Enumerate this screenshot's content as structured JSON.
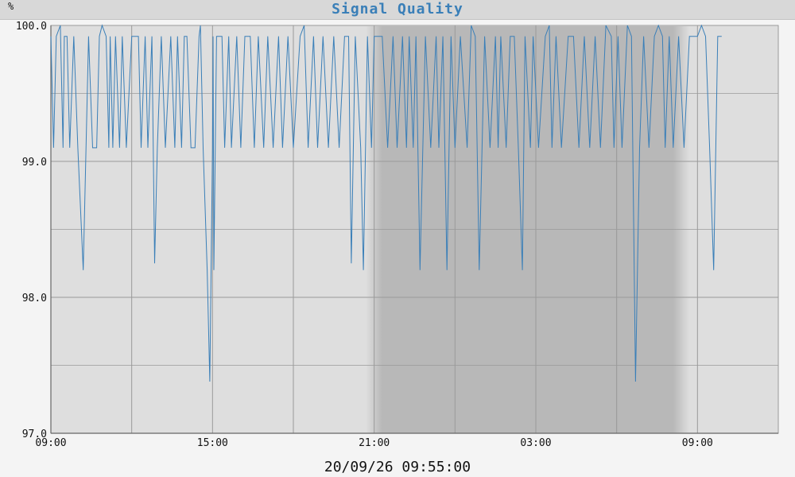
{
  "chart_data": {
    "type": "line",
    "title": "Signal Quality",
    "ylabel": "%",
    "xlabel": "",
    "ylim": [
      97.0,
      100.0
    ],
    "xlim_hours": [
      0,
      27
    ],
    "grid": true,
    "y_ticks": [
      {
        "value": 97.0,
        "label": "97.0"
      },
      {
        "value": 98.0,
        "label": "98.0"
      },
      {
        "value": 99.0,
        "label": "99.0"
      },
      {
        "value": 100.0,
        "label": "100.0"
      }
    ],
    "x_ticks": [
      {
        "hour": 0,
        "label": "09:00"
      },
      {
        "hour": 6,
        "label": "15:00"
      },
      {
        "hour": 12,
        "label": "21:00"
      },
      {
        "hour": 18,
        "label": "03:00"
      },
      {
        "hour": 24,
        "label": "09:00"
      }
    ],
    "night_shading": {
      "start_hour": 11.7,
      "end_hour": 23.7
    },
    "series": [
      {
        "color": "#3a7fb8",
        "x": [
          0.0,
          0.1,
          0.2,
          0.35,
          0.45,
          0.5,
          0.6,
          0.7,
          0.85,
          1.0,
          1.2,
          1.4,
          1.55,
          1.7,
          1.8,
          1.9,
          2.05,
          2.15,
          2.2,
          2.3,
          2.4,
          2.55,
          2.65,
          2.8,
          3.0,
          3.25,
          3.35,
          3.5,
          3.6,
          3.75,
          3.85,
          3.95,
          4.1,
          4.25,
          4.45,
          4.6,
          4.7,
          4.85,
          4.95,
          5.05,
          5.2,
          5.35,
          5.5,
          5.55,
          5.65,
          5.8,
          5.9,
          6.0,
          6.02,
          6.05,
          6.15,
          6.35,
          6.45,
          6.6,
          6.7,
          6.9,
          7.05,
          7.2,
          7.4,
          7.55,
          7.7,
          7.9,
          8.05,
          8.25,
          8.45,
          8.6,
          8.8,
          9.0,
          9.25,
          9.4,
          9.55,
          9.75,
          9.9,
          10.1,
          10.3,
          10.5,
          10.7,
          10.9,
          11.05,
          11.15,
          11.3,
          11.5,
          11.6,
          11.75,
          11.9,
          12.0,
          12.3,
          12.5,
          12.7,
          12.85,
          13.05,
          13.2,
          13.3,
          13.45,
          13.55,
          13.7,
          13.9,
          14.1,
          14.3,
          14.4,
          14.55,
          14.7,
          14.85,
          15.0,
          15.2,
          15.45,
          15.6,
          15.75,
          15.9,
          16.1,
          16.3,
          16.5,
          16.6,
          16.7,
          16.9,
          17.05,
          17.2,
          17.35,
          17.5,
          17.6,
          17.8,
          17.9,
          18.1,
          18.35,
          18.5,
          18.6,
          18.75,
          18.95,
          19.2,
          19.4,
          19.6,
          19.8,
          20.0,
          20.2,
          20.4,
          20.6,
          20.8,
          20.9,
          21.05,
          21.2,
          21.4,
          21.55,
          21.7,
          21.85,
          22.0,
          22.2,
          22.4,
          22.55,
          22.7,
          22.8,
          22.95,
          23.1,
          23.3,
          23.5,
          23.7,
          23.85,
          24.0,
          24.15,
          24.3,
          24.45,
          24.6,
          24.75,
          24.9
        ],
        "y": [
          99.92,
          99.1,
          99.92,
          100.0,
          99.1,
          99.92,
          99.92,
          99.1,
          99.92,
          99.1,
          98.2,
          99.92,
          99.1,
          99.1,
          99.92,
          100.0,
          99.92,
          99.1,
          99.92,
          99.1,
          99.92,
          99.1,
          99.92,
          99.1,
          99.92,
          99.92,
          99.1,
          99.92,
          99.1,
          99.92,
          98.25,
          99.1,
          99.92,
          99.1,
          99.92,
          99.1,
          99.92,
          99.1,
          99.92,
          99.92,
          99.1,
          99.1,
          99.92,
          100.0,
          99.1,
          98.2,
          97.38,
          99.1,
          99.92,
          98.2,
          99.92,
          99.92,
          99.1,
          99.92,
          99.1,
          99.92,
          99.1,
          99.92,
          99.92,
          99.1,
          99.92,
          99.1,
          99.92,
          99.1,
          99.92,
          99.1,
          99.92,
          99.1,
          99.92,
          100.0,
          99.1,
          99.92,
          99.1,
          99.92,
          99.1,
          99.92,
          99.1,
          99.92,
          99.92,
          98.25,
          99.92,
          99.1,
          98.2,
          99.92,
          99.1,
          99.92,
          99.92,
          99.1,
          99.92,
          99.1,
          99.92,
          99.1,
          99.92,
          99.1,
          99.92,
          98.2,
          99.92,
          99.1,
          99.92,
          99.1,
          99.92,
          98.2,
          99.92,
          99.1,
          99.92,
          99.1,
          100.0,
          99.92,
          98.2,
          99.92,
          99.1,
          99.92,
          99.1,
          99.92,
          99.1,
          99.92,
          99.92,
          99.1,
          98.2,
          99.92,
          99.1,
          99.92,
          99.1,
          99.92,
          100.0,
          99.1,
          99.92,
          99.1,
          99.92,
          99.92,
          99.1,
          99.92,
          99.1,
          99.92,
          99.1,
          100.0,
          99.92,
          99.1,
          99.92,
          99.1,
          100.0,
          99.92,
          97.38,
          99.1,
          99.92,
          99.1,
          99.92,
          100.0,
          99.92,
          99.1,
          99.92,
          99.1,
          99.92,
          99.1,
          99.92,
          99.92,
          99.92,
          100.0,
          99.92,
          99.1,
          98.2,
          99.92,
          99.92
        ]
      }
    ],
    "colors": {
      "line": "#3a7fb8",
      "plot_background": "#dedede",
      "night_shading": "#b8b8b8",
      "grid": "#9a9a9a",
      "title": "#3a7fb8"
    }
  },
  "header": {
    "title": "Signal Quality",
    "unit": "%"
  },
  "footer": {
    "timestamp": "20/09/26 09:55:00"
  }
}
